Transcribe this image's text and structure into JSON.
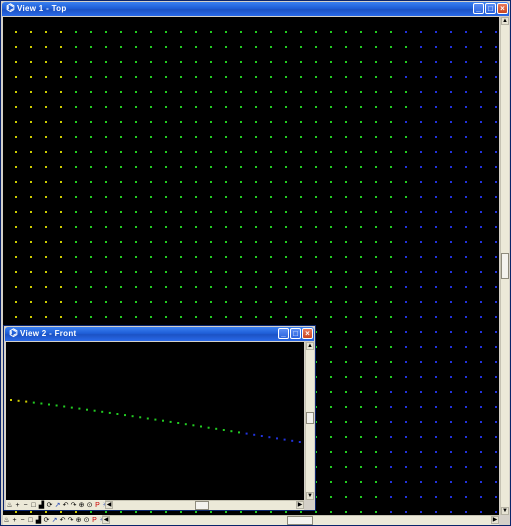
{
  "view1": {
    "title": "View 1 - Top",
    "icon": "microstation-view-icon",
    "controls": [
      "minimize",
      "maximize",
      "close"
    ]
  },
  "view2": {
    "title": "View 2 - Front",
    "icon": "microstation-view-icon",
    "controls": [
      "minimize",
      "maximize",
      "close"
    ]
  },
  "view_tools": [
    {
      "name": "update-view-icon",
      "glyph": "♨"
    },
    {
      "name": "zoom-in-icon",
      "glyph": "+"
    },
    {
      "name": "zoom-out-icon",
      "glyph": "−"
    },
    {
      "name": "window-area-icon",
      "glyph": "□"
    },
    {
      "name": "fit-view-icon",
      "glyph": "▟"
    },
    {
      "name": "rotate-view-icon",
      "glyph": "⟳"
    },
    {
      "name": "pan-view-icon",
      "glyph": "↗"
    },
    {
      "name": "view-previous-icon",
      "glyph": "↶"
    },
    {
      "name": "view-next-icon",
      "glyph": "↷"
    },
    {
      "name": "copy-view-icon",
      "glyph": "⊕"
    },
    {
      "name": "view-attributes-icon",
      "glyph": "⊙"
    },
    {
      "name": "camera-settings-icon",
      "glyph": "P"
    },
    {
      "name": "view-rendering-icon",
      "glyph": "☀"
    }
  ],
  "colors": {
    "title_bar": "#1f5fd8",
    "canvas_bg": "#000000",
    "point_green": "#22cc22",
    "point_yellow": "#cccc00",
    "point_blue": "#2233dd"
  }
}
